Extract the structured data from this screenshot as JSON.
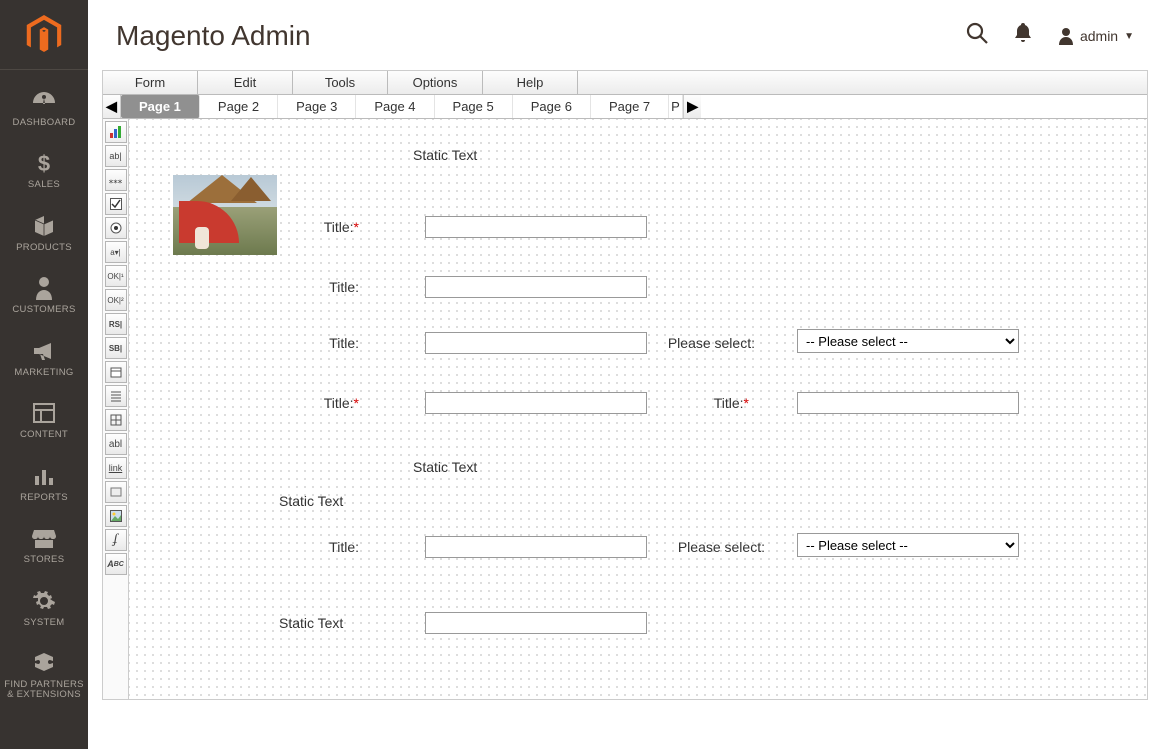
{
  "header": {
    "title": "Magento Admin",
    "user": "admin"
  },
  "sidebar": {
    "items": [
      {
        "label": "DASHBOARD"
      },
      {
        "label": "SALES"
      },
      {
        "label": "PRODUCTS"
      },
      {
        "label": "CUSTOMERS"
      },
      {
        "label": "MARKETING"
      },
      {
        "label": "CONTENT"
      },
      {
        "label": "REPORTS"
      },
      {
        "label": "STORES"
      },
      {
        "label": "SYSTEM"
      },
      {
        "label": "FIND PARTNERS\n& EXTENSIONS"
      }
    ]
  },
  "formBuilder": {
    "menus": [
      "Form",
      "Edit",
      "Tools",
      "Options",
      "Help"
    ],
    "tabs": [
      "Page 1",
      "Page 2",
      "Page 3",
      "Page 4",
      "Page 5",
      "Page 6",
      "Page 7"
    ],
    "partialTab": "P",
    "activeTabIndex": 0,
    "selectPlaceholder": "-- Please select --",
    "elements": {
      "static1": "Static Text",
      "static2": "Static Text",
      "static3": "Static Text",
      "static4": "Static Text",
      "label_title": "Title:",
      "label_please_select": "Please select:"
    }
  }
}
